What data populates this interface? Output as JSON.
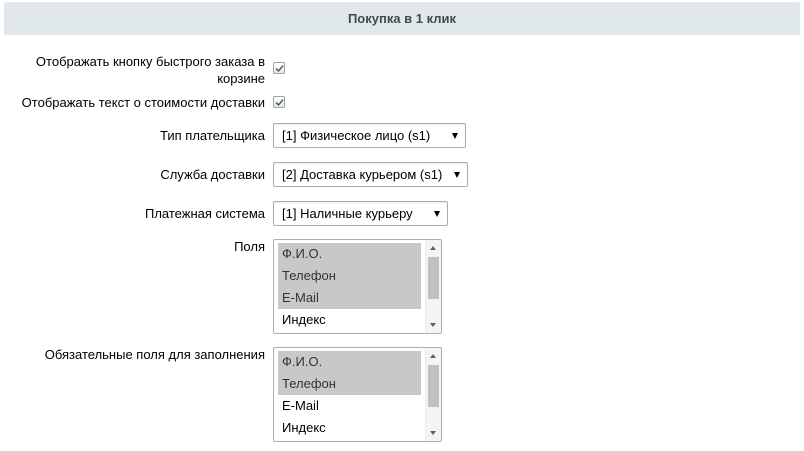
{
  "header": {
    "title": "Покупка в 1 клик"
  },
  "settings": {
    "show_button": {
      "label": "Отображать кнопку быстрого заказа в корзине",
      "checked": true
    },
    "show_delivery_text": {
      "label": "Отображать текст о стоимости доставки",
      "checked": true
    },
    "payer_type": {
      "label": "Тип плательщика",
      "value": "[1] Физическое лицо (s1)"
    },
    "delivery_service": {
      "label": "Служба доставки",
      "value": "[2] Доставка курьером (s1)"
    },
    "payment_system": {
      "label": "Платежная система",
      "value": "[1] Наличные курьеру"
    },
    "fields": {
      "label": "Поля",
      "options": [
        {
          "label": "Ф.И.О.",
          "selected": true
        },
        {
          "label": "Телефон",
          "selected": true
        },
        {
          "label": "E-Mail",
          "selected": true
        },
        {
          "label": "Индекс",
          "selected": false
        }
      ]
    },
    "required_fields": {
      "label": "Обязательные поля для заполнения",
      "options": [
        {
          "label": "Ф.И.О.",
          "selected": true
        },
        {
          "label": "Телефон",
          "selected": true
        },
        {
          "label": "E-Mail",
          "selected": false
        },
        {
          "label": "Индекс",
          "selected": false
        }
      ]
    }
  },
  "colors": {
    "header_bg": "#e1e8ea",
    "header_text": "#3f4b54",
    "selected_option_bg": "#c8c8c8"
  }
}
